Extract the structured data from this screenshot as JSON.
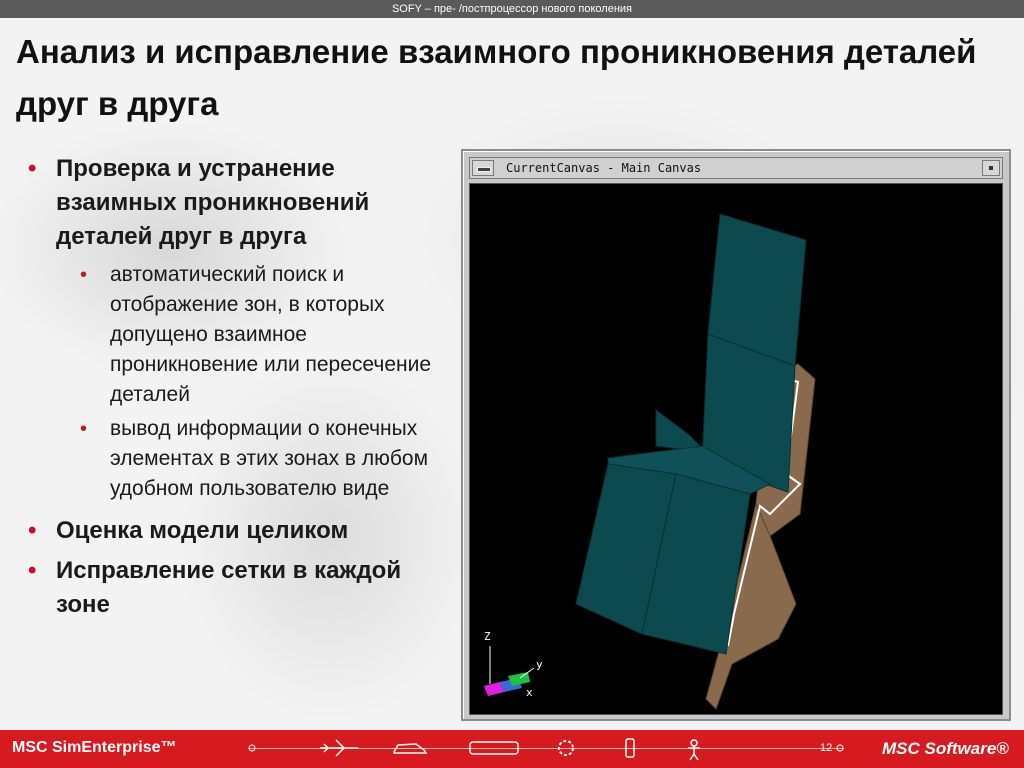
{
  "header": {
    "tagline": "SOFY – пре- /постпроцессор нового поколения",
    "title": "Анализ и исправление взаимного проникновения деталей друг в друга"
  },
  "bullets": [
    {
      "text": "Проверка и устранение взаимных проникновений деталей друг в друга",
      "sub": [
        "автоматический поиск и отображение зон, в которых допущено взаимное проникновение или пересечение деталей",
        "вывод информации о конечных элементах в этих зонах в любом удобном пользователю виде"
      ]
    },
    {
      "text": "Оценка модели целиком"
    },
    {
      "text": "Исправление сетки в каждой зоне"
    }
  ],
  "canvas": {
    "title": "CurrentCanvas - Main Canvas",
    "axis_z": "Z",
    "axis_y": "y",
    "axis_x": "x"
  },
  "footer": {
    "brand_left": "MSC SimEnterprise™",
    "page_number": "12",
    "brand_right": "MSC Software®"
  },
  "colors": {
    "accent_red": "#d71920",
    "panel_teal": "#0d4a50",
    "panel_brown": "#8a6a4d",
    "viewport_bg": "#000000"
  }
}
